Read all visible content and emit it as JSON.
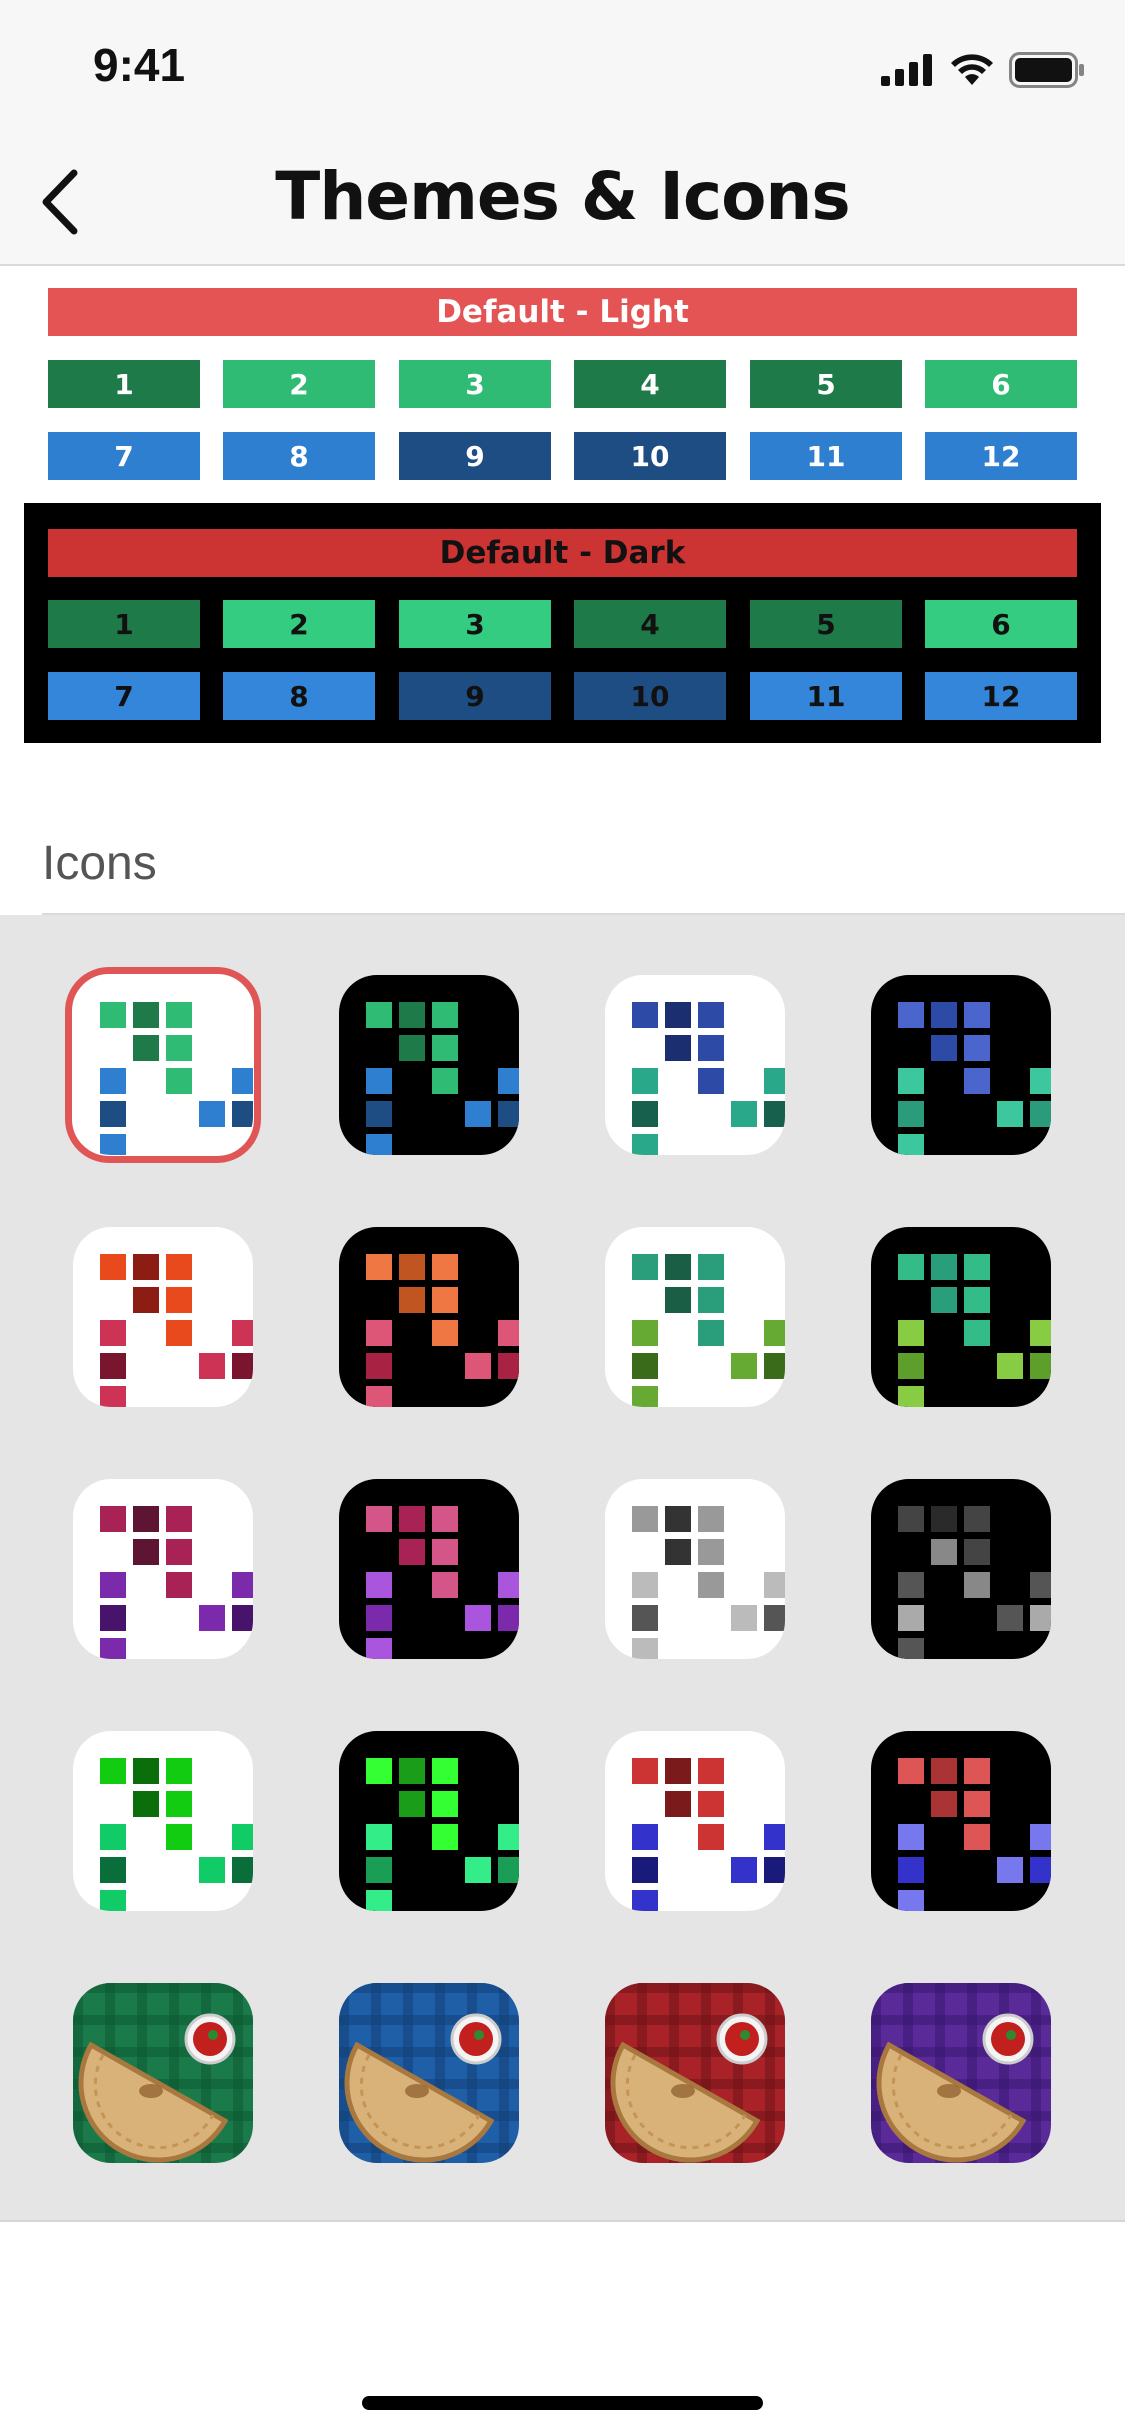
{
  "status_bar": {
    "time": "9:41"
  },
  "nav": {
    "title": "Themes & Icons"
  },
  "themes": [
    {
      "name": "Default - Light",
      "header_color": "#e45454",
      "chips": [
        {
          "label": "1",
          "color": "#1f7a4a"
        },
        {
          "label": "2",
          "color": "#2fbb73"
        },
        {
          "label": "3",
          "color": "#2fbb73"
        },
        {
          "label": "4",
          "color": "#1f7a4a"
        },
        {
          "label": "5",
          "color": "#1f7a4a"
        },
        {
          "label": "6",
          "color": "#2fbb73"
        },
        {
          "label": "7",
          "color": "#2f7fd0"
        },
        {
          "label": "8",
          "color": "#2f7fd0"
        },
        {
          "label": "9",
          "color": "#1d4d82"
        },
        {
          "label": "10",
          "color": "#1d4d82"
        },
        {
          "label": "11",
          "color": "#2f7fd0"
        },
        {
          "label": "12",
          "color": "#2f7fd0"
        }
      ]
    },
    {
      "name": "Default - Dark",
      "header_color": "#cc3333",
      "chips": [
        {
          "label": "1",
          "color": "#1f7a4a"
        },
        {
          "label": "2",
          "color": "#33cc80"
        },
        {
          "label": "3",
          "color": "#33cc80"
        },
        {
          "label": "4",
          "color": "#1f7a4a"
        },
        {
          "label": "5",
          "color": "#1f7a4a"
        },
        {
          "label": "6",
          "color": "#33cc80"
        },
        {
          "label": "7",
          "color": "#3386d9"
        },
        {
          "label": "8",
          "color": "#3386d9"
        },
        {
          "label": "9",
          "color": "#1d4d82"
        },
        {
          "label": "10",
          "color": "#1d4d82"
        },
        {
          "label": "11",
          "color": "#3386d9"
        },
        {
          "label": "12",
          "color": "#3386d9"
        }
      ]
    }
  ],
  "icons_section": {
    "label": "Icons",
    "selected_index": 0,
    "icons": [
      {
        "name": "green-blue-light-icon",
        "bg": "#ffffff",
        "grid": [
          "#2fbb73",
          "#1f7a4a",
          "#2fbb73",
          "",
          "",
          "",
          "#1f7a4a",
          "#2fbb73",
          "",
          "",
          "#2f7fd0",
          "",
          "#2fbb73",
          "",
          "#2f7fd0",
          "#1d4d82",
          "",
          "",
          "#2f7fd0",
          "#1d4d82",
          "#2f7fd0"
        ]
      },
      {
        "name": "green-blue-dark-icon",
        "bg": "#000000",
        "grid": [
          "#2fbb73",
          "#1f7a4a",
          "#2fbb73",
          "",
          "",
          "",
          "#1f7a4a",
          "#2fbb73",
          "",
          "",
          "#2f7fd0",
          "",
          "#2fbb73",
          "",
          "#2f7fd0",
          "#1d4d82",
          "",
          "",
          "#2f7fd0",
          "#1d4d82",
          "#2f7fd0"
        ]
      },
      {
        "name": "navy-teal-light-icon",
        "bg": "#ffffff",
        "grid": [
          "#2c4aa6",
          "#1b2f70",
          "#2c4aa6",
          "",
          "",
          "",
          "#1b2f70",
          "#2c4aa6",
          "",
          "",
          "#2aa88a",
          "",
          "#2c4aa6",
          "",
          "#2aa88a",
          "#17604e",
          "",
          "",
          "#2aa88a",
          "#17604e",
          "#2aa88a"
        ]
      },
      {
        "name": "navy-teal-dark-icon",
        "bg": "#000000",
        "grid": [
          "#4a66cc",
          "#2c4aa6",
          "#4a66cc",
          "",
          "",
          "",
          "#2c4aa6",
          "#4a66cc",
          "",
          "",
          "#3cc79e",
          "",
          "#4a66cc",
          "",
          "#3cc79e",
          "#2a9c7c",
          "",
          "",
          "#3cc79e",
          "#2a9c7c",
          "#3cc79e"
        ]
      },
      {
        "name": "orange-crimson-light-icon",
        "bg": "#ffffff",
        "grid": [
          "#e8491d",
          "#8b1d14",
          "#e8491d",
          "",
          "",
          "",
          "#8b1d14",
          "#e8491d",
          "",
          "",
          "#cc3355",
          "",
          "#e8491d",
          "",
          "#cc3355",
          "#7a1530",
          "",
          "",
          "#cc3355",
          "#7a1530",
          "#cc3355"
        ]
      },
      {
        "name": "orange-crimson-dark-icon",
        "bg": "#000000",
        "grid": [
          "#ee7744",
          "#c05522",
          "#ee7744",
          "",
          "",
          "",
          "#c05522",
          "#ee7744",
          "",
          "",
          "#dd5577",
          "",
          "#ee7744",
          "",
          "#dd5577",
          "#a82244",
          "",
          "",
          "#dd5577",
          "#a82244",
          "#dd5577"
        ]
      },
      {
        "name": "teal-lime-light-icon",
        "bg": "#ffffff",
        "grid": [
          "#2a9d7a",
          "#1a5e46",
          "#2a9d7a",
          "",
          "",
          "",
          "#1a5e46",
          "#2a9d7a",
          "",
          "",
          "#66aa33",
          "",
          "#2a9d7a",
          "",
          "#66aa33",
          "#3a6b1a",
          "",
          "",
          "#66aa33",
          "#3a6b1a",
          "#66aa33"
        ]
      },
      {
        "name": "teal-lime-dark-icon",
        "bg": "#000000",
        "grid": [
          "#33bb88",
          "#2a9d7a",
          "#33bb88",
          "",
          "",
          "",
          "#2a9d7a",
          "#33bb88",
          "",
          "",
          "#88cc44",
          "",
          "#33bb88",
          "",
          "#88cc44",
          "#5e9e2a",
          "",
          "",
          "#88cc44",
          "#5e9e2a",
          "#88cc44"
        ]
      },
      {
        "name": "magenta-purple-light-icon",
        "bg": "#ffffff",
        "grid": [
          "#a82255",
          "#5e1433",
          "#a82255",
          "",
          "",
          "",
          "#5e1433",
          "#a82255",
          "",
          "",
          "#7a2aaa",
          "",
          "#a82255",
          "",
          "#7a2aaa",
          "#48136b",
          "",
          "",
          "#7a2aaa",
          "#48136b",
          "#7a2aaa"
        ]
      },
      {
        "name": "magenta-purple-dark-icon",
        "bg": "#000000",
        "grid": [
          "#d45588",
          "#a82255",
          "#d45588",
          "",
          "",
          "",
          "#a82255",
          "#d45588",
          "",
          "",
          "#aa55dd",
          "",
          "#d45588",
          "",
          "#aa55dd",
          "#7a2aaa",
          "",
          "",
          "#aa55dd",
          "#7a2aaa",
          "#aa55dd"
        ]
      },
      {
        "name": "grayscale-light-icon",
        "bg": "#ffffff",
        "grid": [
          "#999999",
          "#333333",
          "#999999",
          "",
          "",
          "",
          "#333333",
          "#999999",
          "",
          "",
          "#bbbbbb",
          "",
          "#999999",
          "",
          "#bbbbbb",
          "#555555",
          "",
          "",
          "#bbbbbb",
          "#555555",
          "#bbbbbb"
        ]
      },
      {
        "name": "grayscale-dark-icon",
        "bg": "#000000",
        "grid": [
          "#444444",
          "#2a2a2a",
          "#444444",
          "",
          "",
          "",
          "#888888",
          "#444444",
          "",
          "",
          "#555555",
          "",
          "#888888",
          "",
          "#555555",
          "#aaaaaa",
          "",
          "",
          "#555555",
          "#aaaaaa",
          "#555555"
        ]
      },
      {
        "name": "neon-green-light-icon",
        "bg": "#ffffff",
        "grid": [
          "#11cc11",
          "#0a6e0a",
          "#11cc11",
          "",
          "",
          "",
          "#0a6e0a",
          "#11cc11",
          "",
          "",
          "#11cc66",
          "",
          "#11cc11",
          "",
          "#11cc66",
          "#0a6e3a",
          "",
          "",
          "#11cc66",
          "#0a6e3a",
          "#11cc66"
        ]
      },
      {
        "name": "neon-green-dark-icon",
        "bg": "#000000",
        "grid": [
          "#33ff33",
          "#1a9e1a",
          "#33ff33",
          "",
          "",
          "",
          "#1a9e1a",
          "#33ff33",
          "",
          "",
          "#33ee88",
          "",
          "#33ff33",
          "",
          "#33ee88",
          "#1a9e55",
          "",
          "",
          "#33ee88",
          "#1a9e55",
          "#33ee88"
        ]
      },
      {
        "name": "red-blue-light-icon",
        "bg": "#ffffff",
        "grid": [
          "#cc3333",
          "#7a1a1a",
          "#cc3333",
          "",
          "",
          "",
          "#7a1a1a",
          "#cc3333",
          "",
          "",
          "#3333cc",
          "",
          "#cc3333",
          "",
          "#3333cc",
          "#1a1a7a",
          "",
          "",
          "#3333cc",
          "#1a1a7a",
          "#3333cc"
        ]
      },
      {
        "name": "red-blue-dark-icon",
        "bg": "#000000",
        "grid": [
          "#dd5555",
          "#aa3333",
          "#dd5555",
          "",
          "",
          "",
          "#aa3333",
          "#dd5555",
          "",
          "",
          "#7777ee",
          "",
          "#dd5555",
          "",
          "#7777ee",
          "#3333cc",
          "",
          "",
          "#7777ee",
          "#3333cc",
          "#7777ee"
        ]
      },
      {
        "name": "calzone-green-icon",
        "calzone": true,
        "bg": "#1a7a4a",
        "plaid": "#0e5a33"
      },
      {
        "name": "calzone-blue-icon",
        "calzone": true,
        "bg": "#1f5fa8",
        "plaid": "#123f77"
      },
      {
        "name": "calzone-red-icon",
        "calzone": true,
        "bg": "#a82228",
        "plaid": "#701418"
      },
      {
        "name": "calzone-purple-icon",
        "calzone": true,
        "bg": "#5a2a99",
        "plaid": "#3a1670"
      }
    ]
  }
}
